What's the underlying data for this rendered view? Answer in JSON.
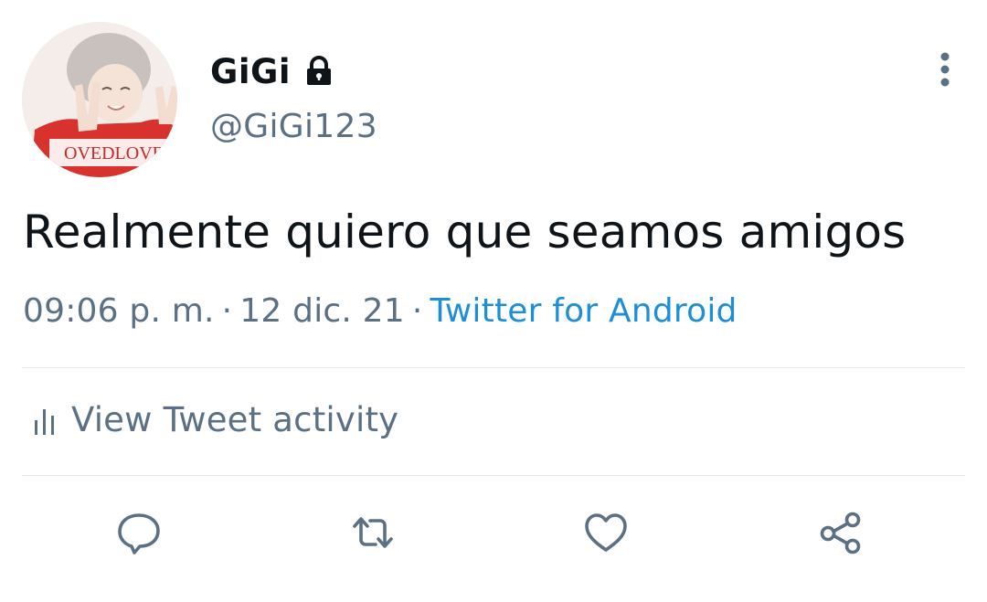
{
  "tweet": {
    "display_name": "GiGi",
    "handle": "@GiGi123",
    "text": "Realmente quiero que seamos amigos",
    "time": "09:06 p. m.",
    "separator": "·",
    "date": "12 dic. 21",
    "source": "Twitter for Android"
  },
  "activity": {
    "label": "View Tweet activity"
  },
  "icons": {
    "protected": "lock-icon",
    "more": "more-vertical-icon",
    "activity": "bar-chart-icon",
    "reply": "reply-icon",
    "retweet": "retweet-icon",
    "like": "heart-icon",
    "share": "share-icon"
  },
  "avatar": {
    "shirt_text": "OVEDLOVE"
  },
  "colors": {
    "text": "#0f1419",
    "secondary": "#5b7083",
    "link": "#1d8fd8",
    "divider": "#e1e6ea"
  }
}
